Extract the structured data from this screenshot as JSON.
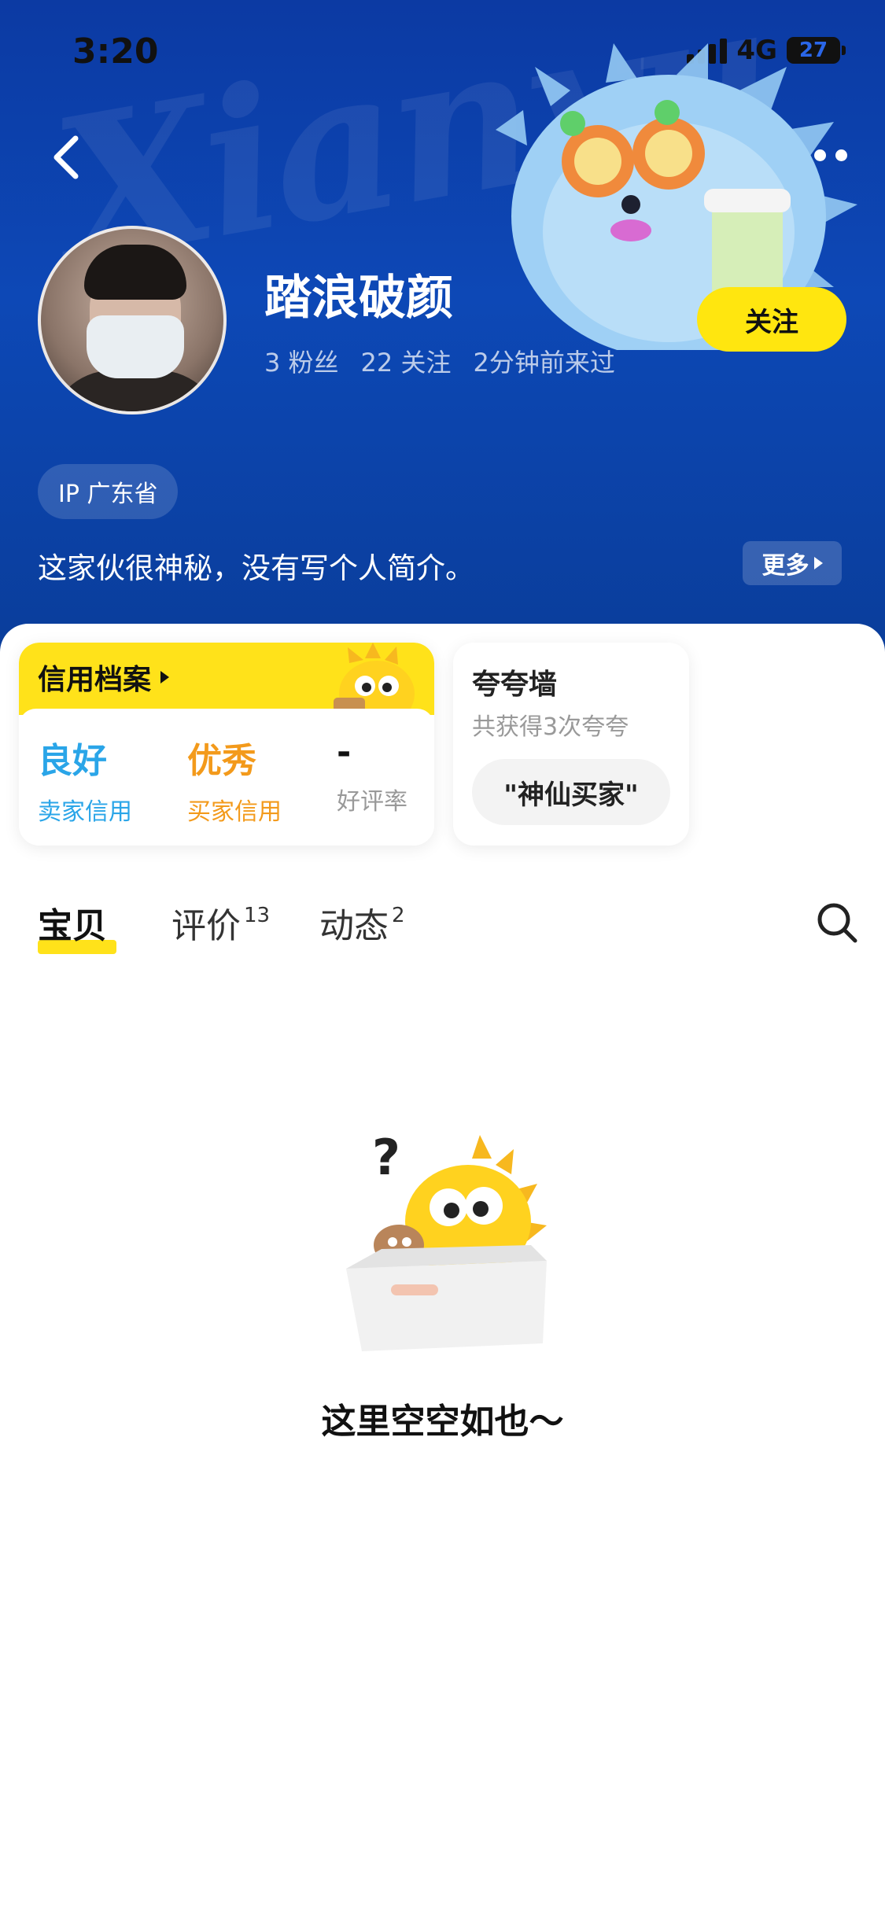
{
  "status_bar": {
    "time": "3:20",
    "network": "4G",
    "battery": "27"
  },
  "header": {
    "watermark": "Xianyu",
    "username": "踏浪破颜",
    "stats": {
      "fans": "3 粉丝",
      "following": "22 关注",
      "last_seen": "2分钟前来过"
    },
    "follow_label": "关注",
    "ip_tag": "IP 广东省",
    "bio": "这家伙很神秘，没有写个人简介。",
    "more_label": "更多"
  },
  "credit_card": {
    "title": "信用档案",
    "items": [
      {
        "value": "良好",
        "label": "卖家信用",
        "color": "#2aa5e8"
      },
      {
        "value": "优秀",
        "label": "买家信用",
        "color": "#f39a1b"
      },
      {
        "value": "-",
        "label": "好评率",
        "color": "#111111"
      }
    ]
  },
  "praise_card": {
    "title": "夸夸墙",
    "subtitle": "共获得3次夸夸",
    "tag": "\"神仙买家\""
  },
  "tabs": [
    {
      "label": "宝贝",
      "badge": ""
    },
    {
      "label": "评价",
      "badge": "13"
    },
    {
      "label": "动态",
      "badge": "2"
    }
  ],
  "empty": {
    "message": "这里空空如也～"
  },
  "colors": {
    "header_bg": "#0d48b6",
    "accent_yellow": "#ffe60f",
    "seller_blue": "#2aa5e8",
    "buyer_orange": "#f39a1b"
  }
}
